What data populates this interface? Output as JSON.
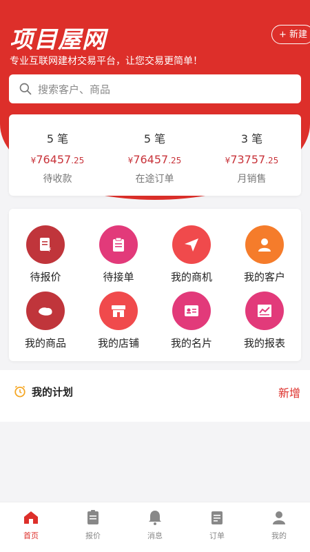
{
  "header": {
    "logo": "项目屋网",
    "new_button": "+ 新建",
    "slogan": "专业互联网建材交易平台，让您交易更简单！",
    "search_placeholder": "搜索客户、商品"
  },
  "stats": [
    {
      "count": "5 笔",
      "currency": "¥",
      "amount_int": "76457",
      "amount_dec": ".25",
      "label": "待收款"
    },
    {
      "count": "5 笔",
      "currency": "¥",
      "amount_int": "76457",
      "amount_dec": ".25",
      "label": "在途订单"
    },
    {
      "count": "3 笔",
      "currency": "¥",
      "amount_int": "73757",
      "amount_dec": ".25",
      "label": "月销售"
    }
  ],
  "menu": [
    {
      "label": "待报价",
      "icon": "quote-doc-icon",
      "color": "#c0353b"
    },
    {
      "label": "待接单",
      "icon": "clipboard-icon",
      "color": "#e23a7a"
    },
    {
      "label": "我的商机",
      "icon": "paper-plane-icon",
      "color": "#f04a4c"
    },
    {
      "label": "我的客户",
      "icon": "person-icon",
      "color": "#f57c2b"
    },
    {
      "label": "我的商品",
      "icon": "goods-icon",
      "color": "#c0353b"
    },
    {
      "label": "我的店铺",
      "icon": "store-icon",
      "color": "#f04a4c"
    },
    {
      "label": "我的名片",
      "icon": "id-card-icon",
      "color": "#e23a7a"
    },
    {
      "label": "我的报表",
      "icon": "chart-icon",
      "color": "#e23a7a"
    }
  ],
  "plan": {
    "title": "我的计划",
    "add": "新增"
  },
  "tabs": [
    {
      "label": "首页",
      "icon": "home-icon",
      "active": true
    },
    {
      "label": "报价",
      "icon": "quote-icon",
      "active": false
    },
    {
      "label": "消息",
      "icon": "bell-icon",
      "active": false
    },
    {
      "label": "订单",
      "icon": "order-icon",
      "active": false
    },
    {
      "label": "我的",
      "icon": "user-icon",
      "active": false
    }
  ],
  "colors": {
    "brand": "#dd2f2a",
    "price": "#c8333a"
  }
}
